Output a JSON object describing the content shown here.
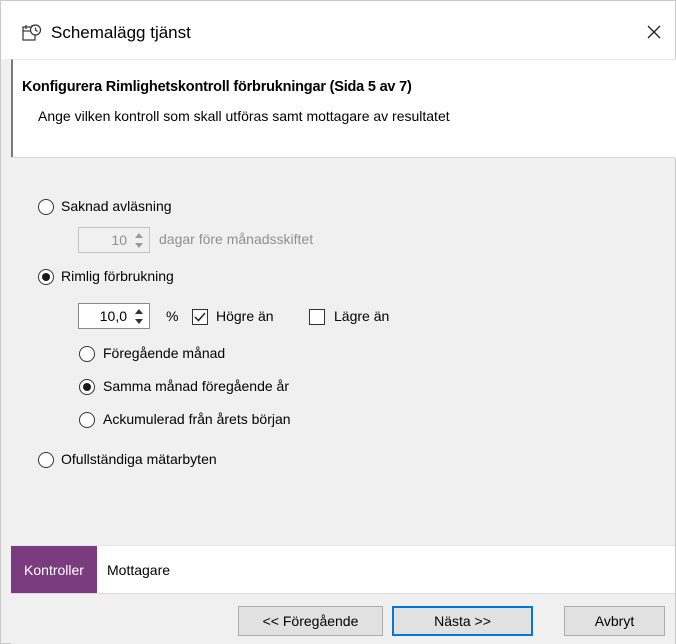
{
  "window": {
    "title": "Schemalägg tjänst",
    "icon": "schedule-service-icon",
    "close_icon": "close-icon"
  },
  "header": {
    "title": "Konfigurera Rimlighetskontroll förbrukningar (Sida 5 av 7)",
    "subtitle": "Ange vilken kontroll som skall utföras samt mottagare av resultatet"
  },
  "options": {
    "missing_reading": {
      "label": "Saknad avläsning",
      "selected": false,
      "days_value": "10",
      "days_label": "dagar före månadsskiftet",
      "enabled": false
    },
    "reasonable_consumption": {
      "label": "Rimlig förbrukning",
      "selected": true,
      "percent_value": "10,0",
      "percent_unit": "%",
      "higher_label": "Högre än",
      "higher_checked": true,
      "lower_label": "Lägre än",
      "lower_checked": false,
      "sub_options": [
        {
          "label": "Föregående månad",
          "selected": false
        },
        {
          "label": "Samma månad föregående år",
          "selected": true
        },
        {
          "label": "Ackumulerad från årets början",
          "selected": false
        }
      ]
    },
    "incomplete_meter_changes": {
      "label": "Ofullständiga mätarbyten",
      "selected": false
    }
  },
  "tabs": [
    {
      "label": "Kontroller",
      "active": true
    },
    {
      "label": "Mottagare",
      "active": false
    }
  ],
  "buttons": {
    "previous": "<< Föregående",
    "next": "Nästa >>",
    "cancel": "Avbryt"
  },
  "colors": {
    "active_tab": "#7a3c7f",
    "primary_button_border": "#0078d7"
  }
}
